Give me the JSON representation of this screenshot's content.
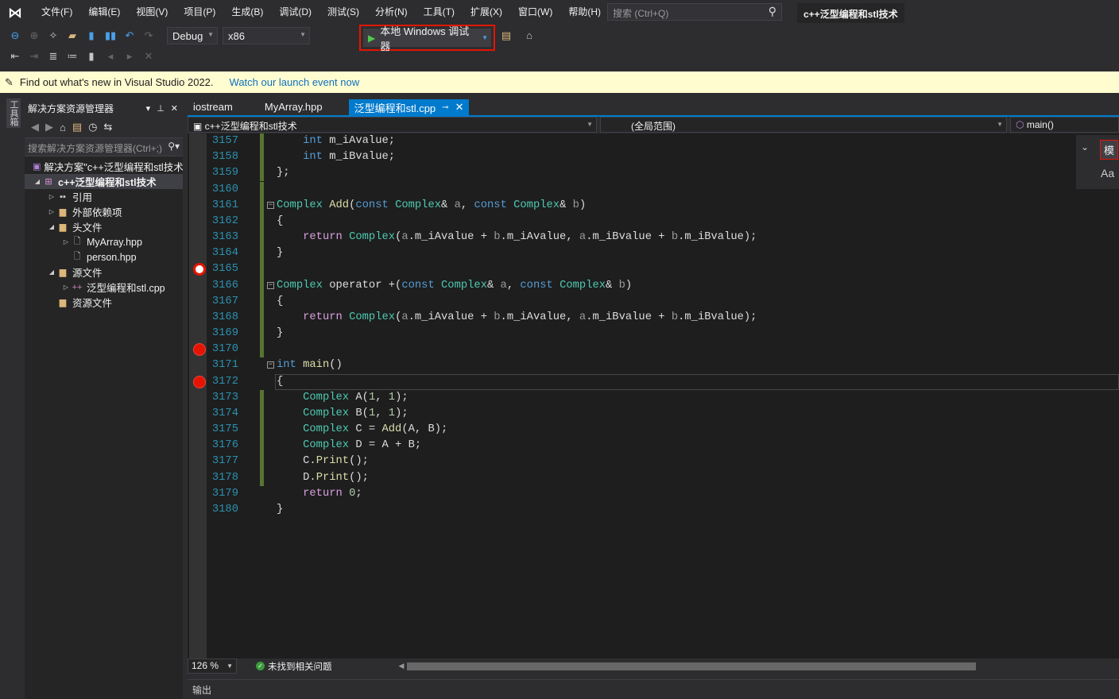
{
  "menu": [
    "文件(F)",
    "编辑(E)",
    "视图(V)",
    "项目(P)",
    "生成(B)",
    "调试(D)",
    "测试(S)",
    "分析(N)",
    "工具(T)",
    "扩展(X)",
    "窗口(W)",
    "帮助(H)"
  ],
  "search_placeholder": "搜索 (Ctrl+Q)",
  "solution_title": "c++泛型编程和stl技术",
  "toolbar": {
    "config": "Debug",
    "platform": "x86",
    "run_label": "本地 Windows 调试器"
  },
  "infobar": {
    "message": "Find out what's new in Visual Studio 2022.",
    "link": "Watch our launch event now"
  },
  "toolbox_label": "工具箱",
  "solution_explorer": {
    "title": "解决方案资源管理器",
    "search_placeholder": "搜索解决方案资源管理器(Ctrl+;)",
    "items": [
      {
        "label": "解决方案\"c++泛型编程和stl技术\"",
        "indent": 0,
        "tw": "",
        "icon": "▣",
        "color": "#b180d7"
      },
      {
        "label": "c++泛型编程和stl技术",
        "indent": 0,
        "tw": "◢",
        "icon": "⊞",
        "color": "#c586c0",
        "selected": true
      },
      {
        "label": "引用",
        "indent": 1,
        "tw": "▷",
        "icon": "▪▪",
        "color": "#ccc"
      },
      {
        "label": "外部依赖项",
        "indent": 1,
        "tw": "▷",
        "icon": "▆",
        "color": "#dcb67a"
      },
      {
        "label": "头文件",
        "indent": 1,
        "tw": "◢",
        "icon": "▆",
        "color": "#dcb67a"
      },
      {
        "label": "MyArray.hpp",
        "indent": 2,
        "tw": "▷",
        "icon": "🗋",
        "color": "#ccc"
      },
      {
        "label": "person.hpp",
        "indent": 2,
        "tw": "",
        "icon": "🗋",
        "color": "#ccc"
      },
      {
        "label": "源文件",
        "indent": 1,
        "tw": "◢",
        "icon": "▆",
        "color": "#dcb67a"
      },
      {
        "label": "泛型编程和stl.cpp",
        "indent": 2,
        "tw": "▷",
        "icon": "++",
        "color": "#c586c0"
      },
      {
        "label": "资源文件",
        "indent": 1,
        "tw": "",
        "icon": "▆",
        "color": "#dcb67a"
      }
    ]
  },
  "tabs": [
    "iostream",
    "MyArray.hpp",
    "泛型编程和stl.cpp"
  ],
  "nav": {
    "project": "c++泛型编程和stl技术",
    "scope": "(全局范围)",
    "member": "main()"
  },
  "find_widget": {
    "find_label": "模",
    "case_label": "Aa"
  },
  "breakpoints": [
    {
      "line": 3165,
      "hollow": true
    },
    {
      "line": 3170,
      "hollow": false
    },
    {
      "line": 3172,
      "hollow": false
    }
  ],
  "current_line": 3172,
  "code": [
    {
      "n": 3157,
      "t": [
        [
          "x",
          "    "
        ],
        [
          "k",
          "int"
        ],
        [
          "x",
          " m_iAvalue;"
        ]
      ]
    },
    {
      "n": 3158,
      "t": [
        [
          "x",
          "    "
        ],
        [
          "k",
          "int"
        ],
        [
          "x",
          " m_iBvalue;"
        ]
      ]
    },
    {
      "n": 3159,
      "t": [
        [
          "x",
          "};"
        ]
      ]
    },
    {
      "n": 3160,
      "t": []
    },
    {
      "n": 3161,
      "fold": true,
      "t": [
        [
          "t",
          "Complex"
        ],
        [
          "x",
          " "
        ],
        [
          "f",
          "Add"
        ],
        [
          "x",
          "("
        ],
        [
          "k",
          "const"
        ],
        [
          "x",
          " "
        ],
        [
          "t",
          "Complex"
        ],
        [
          "x",
          "& "
        ],
        [
          "p",
          "a"
        ],
        [
          "x",
          ", "
        ],
        [
          "k",
          "const"
        ],
        [
          "x",
          " "
        ],
        [
          "t",
          "Complex"
        ],
        [
          "x",
          "& "
        ],
        [
          "p",
          "b"
        ],
        [
          "x",
          ")"
        ]
      ]
    },
    {
      "n": 3162,
      "t": [
        [
          "x",
          "{"
        ]
      ]
    },
    {
      "n": 3163,
      "t": [
        [
          "x",
          "    "
        ],
        [
          "r",
          "return"
        ],
        [
          "x",
          " "
        ],
        [
          "t",
          "Complex"
        ],
        [
          "x",
          "("
        ],
        [
          "p",
          "a"
        ],
        [
          "x",
          ".m_iAvalue + "
        ],
        [
          "p",
          "b"
        ],
        [
          "x",
          ".m_iAvalue, "
        ],
        [
          "p",
          "a"
        ],
        [
          "x",
          ".m_iBvalue + "
        ],
        [
          "p",
          "b"
        ],
        [
          "x",
          ".m_iBvalue);"
        ]
      ]
    },
    {
      "n": 3164,
      "t": [
        [
          "x",
          "}"
        ]
      ]
    },
    {
      "n": 3165,
      "t": []
    },
    {
      "n": 3166,
      "fold": true,
      "t": [
        [
          "t",
          "Complex"
        ],
        [
          "x",
          " operator +("
        ],
        [
          "k",
          "const"
        ],
        [
          "x",
          " "
        ],
        [
          "t",
          "Complex"
        ],
        [
          "x",
          "& "
        ],
        [
          "p",
          "a"
        ],
        [
          "x",
          ", "
        ],
        [
          "k",
          "const"
        ],
        [
          "x",
          " "
        ],
        [
          "t",
          "Complex"
        ],
        [
          "x",
          "& "
        ],
        [
          "p",
          "b"
        ],
        [
          "x",
          ")"
        ]
      ]
    },
    {
      "n": 3167,
      "t": [
        [
          "x",
          "{"
        ]
      ]
    },
    {
      "n": 3168,
      "t": [
        [
          "x",
          "    "
        ],
        [
          "r",
          "return"
        ],
        [
          "x",
          " "
        ],
        [
          "t",
          "Complex"
        ],
        [
          "x",
          "("
        ],
        [
          "p",
          "a"
        ],
        [
          "x",
          ".m_iAvalue + "
        ],
        [
          "p",
          "b"
        ],
        [
          "x",
          ".m_iAvalue, "
        ],
        [
          "p",
          "a"
        ],
        [
          "x",
          ".m_iBvalue + "
        ],
        [
          "p",
          "b"
        ],
        [
          "x",
          ".m_iBvalue);"
        ]
      ]
    },
    {
      "n": 3169,
      "t": [
        [
          "x",
          "}"
        ]
      ]
    },
    {
      "n": 3170,
      "t": []
    },
    {
      "n": 3171,
      "fold": true,
      "t": [
        [
          "k",
          "int"
        ],
        [
          "x",
          " "
        ],
        [
          "f",
          "main"
        ],
        [
          "x",
          "()"
        ]
      ]
    },
    {
      "n": 3172,
      "t": [
        [
          "x",
          "{"
        ]
      ]
    },
    {
      "n": 3173,
      "t": [
        [
          "x",
          "    "
        ],
        [
          "t",
          "Complex"
        ],
        [
          "x",
          " A("
        ],
        [
          "n",
          "1"
        ],
        [
          "x",
          ", "
        ],
        [
          "n",
          "1"
        ],
        [
          "x",
          ");"
        ]
      ]
    },
    {
      "n": 3174,
      "t": [
        [
          "x",
          "    "
        ],
        [
          "t",
          "Complex"
        ],
        [
          "x",
          " B("
        ],
        [
          "n",
          "1"
        ],
        [
          "x",
          ", "
        ],
        [
          "n",
          "1"
        ],
        [
          "x",
          ");"
        ]
      ]
    },
    {
      "n": 3175,
      "t": [
        [
          "x",
          "    "
        ],
        [
          "t",
          "Complex"
        ],
        [
          "x",
          " C = "
        ],
        [
          "f",
          "Add"
        ],
        [
          "x",
          "(A, B);"
        ]
      ]
    },
    {
      "n": 3176,
      "t": [
        [
          "x",
          "    "
        ],
        [
          "t",
          "Complex"
        ],
        [
          "x",
          " D = A + B;"
        ]
      ]
    },
    {
      "n": 3177,
      "t": [
        [
          "x",
          "    C."
        ],
        [
          "f",
          "Print"
        ],
        [
          "x",
          "();"
        ]
      ]
    },
    {
      "n": 3178,
      "t": [
        [
          "x",
          "    D."
        ],
        [
          "f",
          "Print"
        ],
        [
          "x",
          "();"
        ]
      ]
    },
    {
      "n": 3179,
      "t": [
        [
          "x",
          "    "
        ],
        [
          "r",
          "return"
        ],
        [
          "x",
          " "
        ],
        [
          "n",
          "0"
        ],
        [
          "x",
          ";"
        ]
      ]
    },
    {
      "n": 3180,
      "t": [
        [
          "x",
          "}"
        ]
      ]
    }
  ],
  "changed_lines": [
    3157,
    3158,
    3159,
    3160,
    3161,
    3162,
    3163,
    3164,
    3165,
    3166,
    3167,
    3168,
    3169,
    3170,
    3173,
    3174,
    3175,
    3176,
    3177,
    3178
  ],
  "status": {
    "zoom": "126 %",
    "issues": "未找到相关问题"
  },
  "output_label": "输出"
}
